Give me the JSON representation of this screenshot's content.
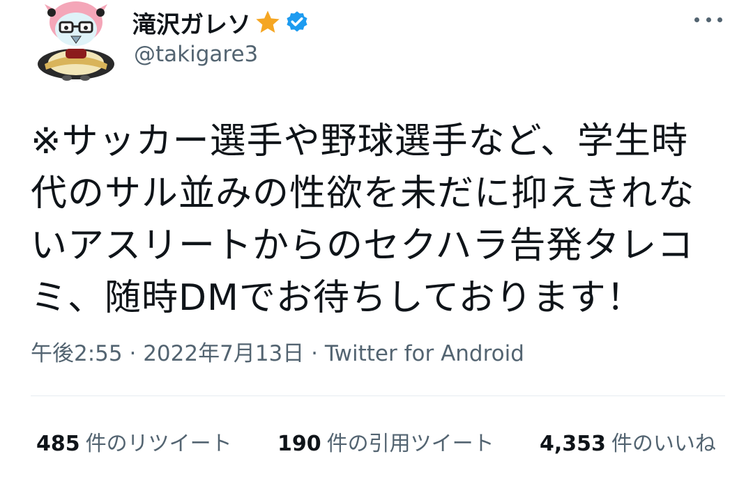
{
  "user": {
    "display_name": "滝沢ガレソ",
    "handle": "@takigare3",
    "star_icon": "star-icon",
    "verified_icon": "verified-badge-icon",
    "star_color": "#f5a623",
    "verified_color": "#1d9bf0"
  },
  "tweet": {
    "lines": [
      "※サッカー選手や野球選手など、学生時",
      "代のサル並みの性欲を未だに抑えきれな",
      "いアスリートからのセクハラ告発タレコ",
      "ミ、随時DMでお待ちしております！"
    ]
  },
  "meta": {
    "time": "午後2:55",
    "separator": "·",
    "date": "2022年7月13日",
    "source": "Twitter for Android"
  },
  "stats": {
    "retweets_count": "485",
    "retweets_label": "件のリツイート",
    "quotes_count": "190",
    "quotes_label": "件の引用ツイート",
    "likes_count": "4,353",
    "likes_label": "件のいいね"
  },
  "colors": {
    "text_primary": "#0f1419",
    "text_secondary": "#536471",
    "divider": "#e6ecf0"
  }
}
